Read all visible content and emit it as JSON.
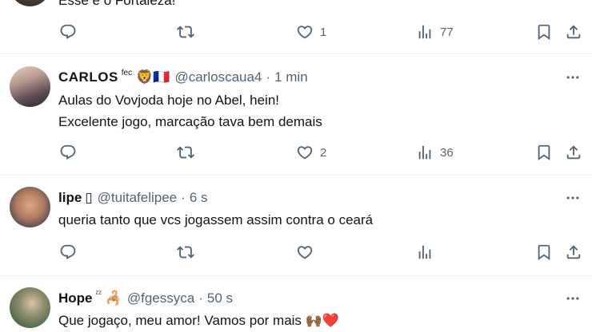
{
  "tweets": [
    {
      "name": "",
      "handle": "",
      "time": "",
      "text": [
        "Esse é o Fortaleza!"
      ],
      "stats": {
        "replies": "",
        "retweets": "",
        "likes": "1",
        "views": "77"
      }
    },
    {
      "name": "CARLOS",
      "name_sup": "fec",
      "emojis": "🦁🇫🇷",
      "handle": "@carloscaua4",
      "dot": "·",
      "time": "1 min",
      "text": [
        "Aulas do Vovjoda hoje no Abel, hein!",
        "Excelente jogo, marcação tava bem demais"
      ],
      "stats": {
        "replies": "",
        "retweets": "",
        "likes": "2",
        "views": "36"
      }
    },
    {
      "name": "lipe",
      "name_suffix": "▯",
      "handle": "@tuitafelipee",
      "dot": "·",
      "time": "6 s",
      "text": [
        "queria tanto que vcs jogassem assim contra o ceará"
      ],
      "stats": {
        "replies": "",
        "retweets": "",
        "likes": "",
        "views": ""
      }
    },
    {
      "name": "Hope",
      "name_sup": "ᶻᶻ",
      "emojis": "🦂",
      "handle": "@fgessyca",
      "dot": "·",
      "time": "50 s",
      "text": [
        "Que jogaço, meu amor! Vamos por mais 🙌🏾❤️"
      ]
    }
  ],
  "icons": {
    "reply": "reply-icon",
    "retweet": "retweet-icon",
    "like": "heart-icon",
    "views": "views-icon",
    "bookmark": "bookmark-icon",
    "share": "share-icon",
    "more": "more-icon"
  },
  "colors": {
    "text": "#0f1419",
    "secondary": "#536471",
    "divider": "#eff3f4"
  }
}
